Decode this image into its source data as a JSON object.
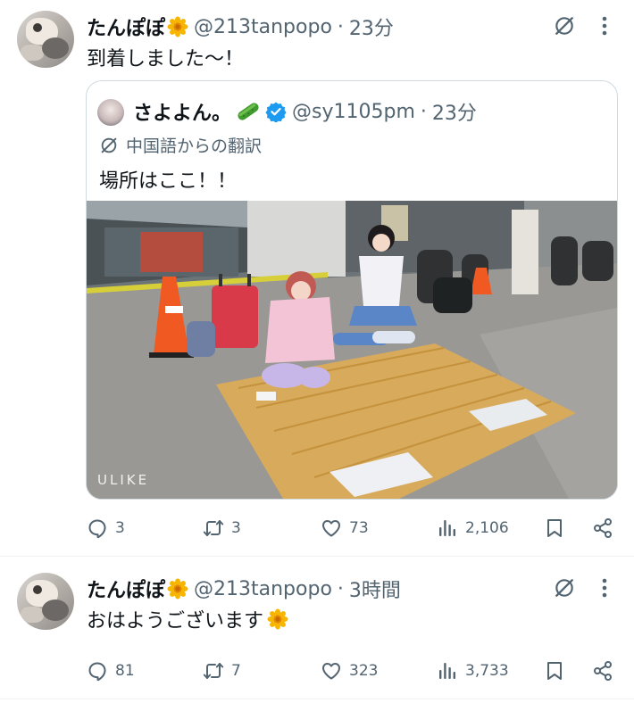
{
  "tweets": [
    {
      "author_name": "たんぽぽ",
      "author_emoji": "sunflower-emoji",
      "handle": "@213tanpopo",
      "separator": "·",
      "time": "23分",
      "text": "到着しました〜！",
      "quote": {
        "author_name": "さよよん。",
        "author_emoji": "cucumber-emoji",
        "verified": true,
        "handle": "@sy1105pm",
        "separator": "·",
        "time": "23分",
        "translation_label": "中国語からの翻訳",
        "text": "場所はここ！！",
        "image_watermark": "ULIKE"
      },
      "stats": {
        "replies": "3",
        "reposts": "3",
        "likes": "73",
        "views": "2,106"
      }
    },
    {
      "author_name": "たんぽぽ",
      "author_emoji": "sunflower-emoji",
      "handle": "@213tanpopo",
      "separator": "·",
      "time": "3時間",
      "text": "おはようございます",
      "text_emoji": "sunflower-emoji",
      "stats": {
        "replies": "81",
        "reposts": "7",
        "likes": "323",
        "views": "3,733"
      }
    }
  ],
  "colors": {
    "text": "#0f1419",
    "secondary": "#536471",
    "border": "#cfd9de",
    "verified": "#1d9bf0",
    "sunflower": "#f5b800"
  }
}
